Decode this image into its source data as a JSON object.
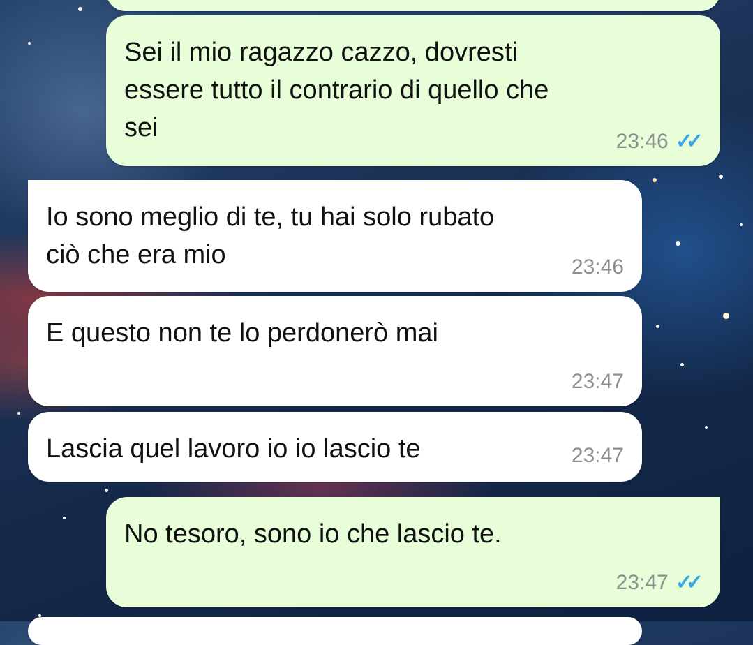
{
  "messages": [
    {
      "id": 0,
      "direction": "outgoing",
      "text": "",
      "time": "",
      "status": ""
    },
    {
      "id": 1,
      "direction": "outgoing",
      "text": "Sei il mio ragazzo cazzo, dovresti\nessere tutto il contrario di quello che\nsei",
      "time": "23:46",
      "status": "read"
    },
    {
      "id": 2,
      "direction": "incoming",
      "text": "Io sono meglio di te, tu hai solo rubato\nciò che era mio",
      "time": "23:46"
    },
    {
      "id": 3,
      "direction": "incoming",
      "text": "E questo non te lo perdonerò mai",
      "time": "23:47"
    },
    {
      "id": 4,
      "direction": "incoming",
      "text": "Lascia quel lavoro io io lascio te",
      "time": "23:47"
    },
    {
      "id": 5,
      "direction": "outgoing",
      "text": "No tesoro, sono io che lascio te.",
      "time": "23:47",
      "status": "read"
    }
  ],
  "icons": {
    "read_receipt": "double-check-icon",
    "read_receipt_color": "#35a5e8"
  },
  "colors": {
    "outgoing_bubble": "#e7fed9",
    "incoming_bubble": "#ffffff",
    "timestamp": "#8a8f8c"
  }
}
